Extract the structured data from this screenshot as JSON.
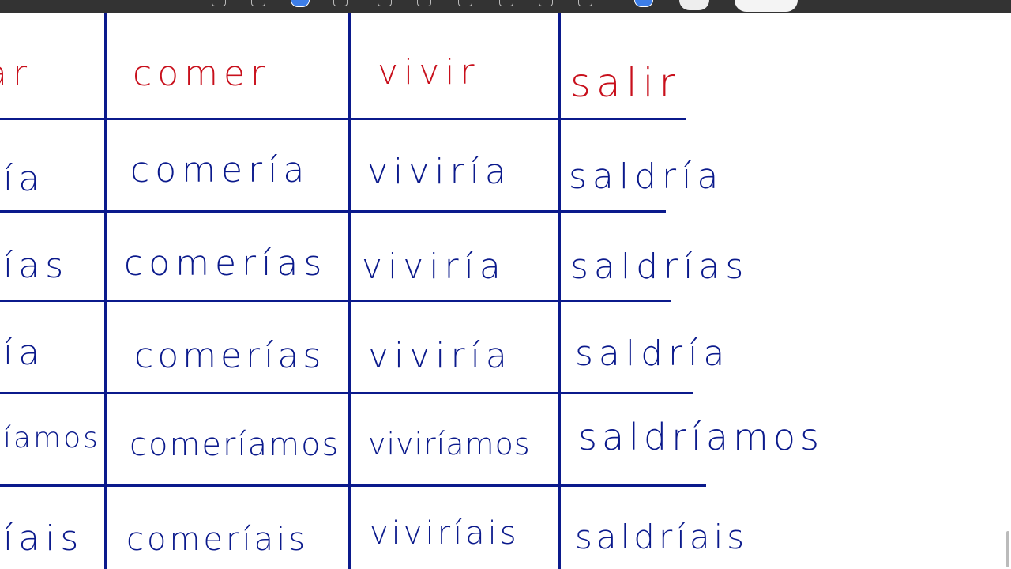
{
  "toolbar": {
    "tools": [
      "keyboard-icon",
      "pen-icon",
      "highlighter-icon",
      "eraser-icon",
      "lasso-icon",
      "shape-icon",
      "image-icon",
      "text-icon",
      "camera-icon",
      "pointer-icon"
    ],
    "colors": [
      "#3d7ee8",
      "#eeeeee",
      "#f4f4f4"
    ]
  },
  "table": {
    "headers": [
      "ar",
      "comer",
      "vivir",
      "salir"
    ],
    "rows": [
      [
        "ía",
        "comería",
        "viviría",
        "saldría"
      ],
      [
        "ías",
        "comerías",
        "viviría",
        "saldrías"
      ],
      [
        "ía",
        "comerías",
        "viviría",
        "saldría"
      ],
      [
        "íamos",
        "comeríamos",
        "viviríamos",
        "saldríamos"
      ],
      [
        "íais",
        "comeríais",
        "viviríais",
        "saldríais"
      ]
    ]
  },
  "colors": {
    "ink_header": "#c8101c",
    "ink_body": "#0b1a8c",
    "toolbar_bg": "#333333"
  }
}
